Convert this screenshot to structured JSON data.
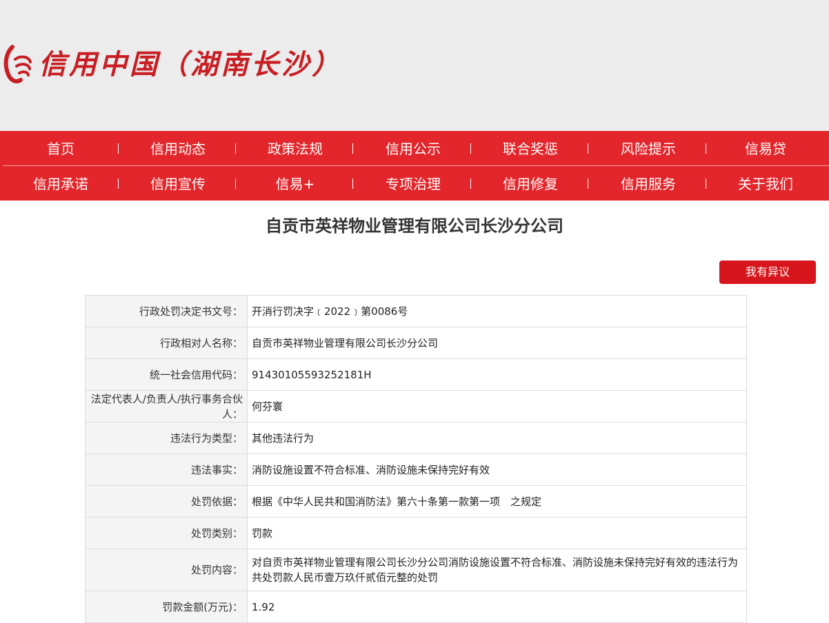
{
  "header": {
    "logo_text": "信用中国（湖南长沙）"
  },
  "nav": {
    "row1": [
      "首页",
      "信用动态",
      "政策法规",
      "信用公示",
      "联合奖惩",
      "风险提示",
      "信易贷"
    ],
    "row2": [
      "信用承诺",
      "信用宣传",
      "信易+",
      "专项治理",
      "信用修复",
      "信用服务",
      "关于我们"
    ]
  },
  "page": {
    "title": "自贡市英祥物业管理有限公司长沙分公司",
    "objection_button": "我有异议"
  },
  "details": [
    {
      "label": "行政处罚决定书文号：",
      "value": "开消行罚决字﹝2022﹞第0086号"
    },
    {
      "label": "行政相对人名称：",
      "value": "自贡市英祥物业管理有限公司长沙分公司"
    },
    {
      "label": "统一社会信用代码：",
      "value": "91430105593252181H"
    },
    {
      "label": "法定代表人/负责人/执行事务合伙人：",
      "value": "何芬寰"
    },
    {
      "label": "违法行为类型：",
      "value": "其他违法行为"
    },
    {
      "label": "违法事实：",
      "value": "消防设施设置不符合标准、消防设施未保持完好有效"
    },
    {
      "label": "处罚依据：",
      "value": "根据《中华人民共和国消防法》第六十条第一款第一项　之规定"
    },
    {
      "label": "处罚类别：",
      "value": "罚款"
    },
    {
      "label": "处罚内容：",
      "value": "对自贡市英祥物业管理有限公司长沙分公司消防设施设置不符合标准、消防设施未保持完好有效的违法行为共处罚款人民币壹万玖仟贰佰元整的处罚"
    },
    {
      "label": "罚款金额(万元)：",
      "value": "1.92"
    }
  ],
  "colors": {
    "nav_bg": "#e3262b",
    "brand_red": "#c81e23",
    "button_bg": "#d7151c"
  }
}
